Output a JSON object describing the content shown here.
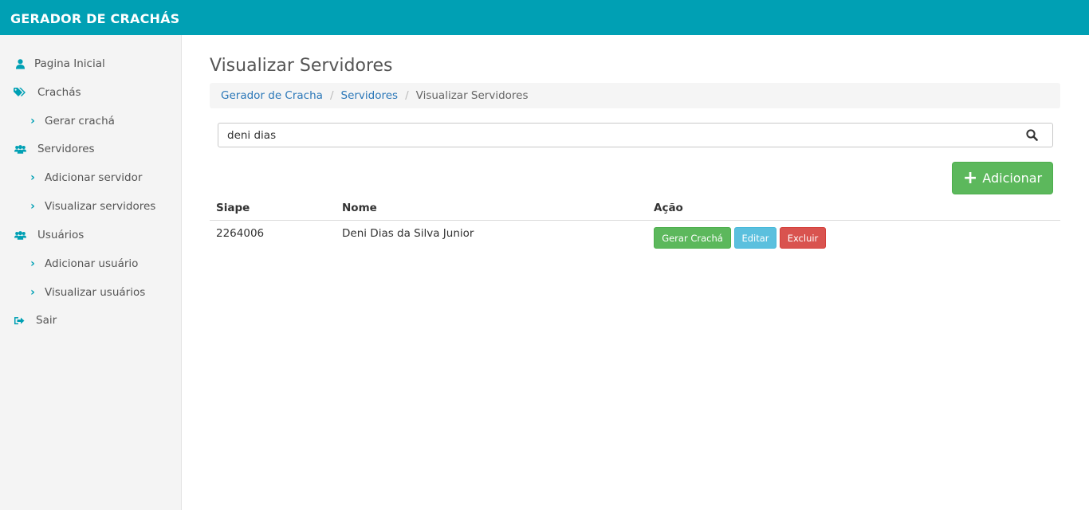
{
  "app": {
    "brand": "GERADOR DE CRACHÁS"
  },
  "colors": {
    "brand": "#00a0b4",
    "success": "#5cb85c",
    "info": "#5bc0de",
    "danger": "#d9534f",
    "link": "#2a77b8"
  },
  "sidebar": {
    "items": [
      {
        "label": "Pagina Inicial",
        "icon": "user-icon"
      },
      {
        "label": "Crachás",
        "icon": "tags-icon"
      },
      {
        "label": "Gerar crachá",
        "icon": "chevron-right-icon"
      },
      {
        "label": "Servidores",
        "icon": "users-icon"
      },
      {
        "label": "Adicionar servidor",
        "icon": "chevron-right-icon"
      },
      {
        "label": "Visualizar servidores",
        "icon": "chevron-right-icon"
      },
      {
        "label": "Usuários",
        "icon": "users-icon"
      },
      {
        "label": "Adicionar usuário",
        "icon": "chevron-right-icon"
      },
      {
        "label": "Visualizar usuários",
        "icon": "chevron-right-icon"
      },
      {
        "label": "Sair",
        "icon": "sign-out-icon"
      }
    ]
  },
  "main": {
    "title": "Visualizar Servidores",
    "breadcrumb": [
      "Gerador de Cracha",
      "Servidores",
      "Visualizar Servidores"
    ],
    "search": {
      "value": "deni dias",
      "icon": "search-icon"
    },
    "add_button": "Adicionar",
    "table": {
      "headers": [
        "Siape",
        "Nome",
        "Ação"
      ],
      "rows": [
        {
          "siape": "2264006",
          "nome": "Deni Dias da Silva Junior",
          "actions": [
            "Gerar Crachá",
            "Editar",
            "Excluir"
          ]
        }
      ]
    }
  }
}
